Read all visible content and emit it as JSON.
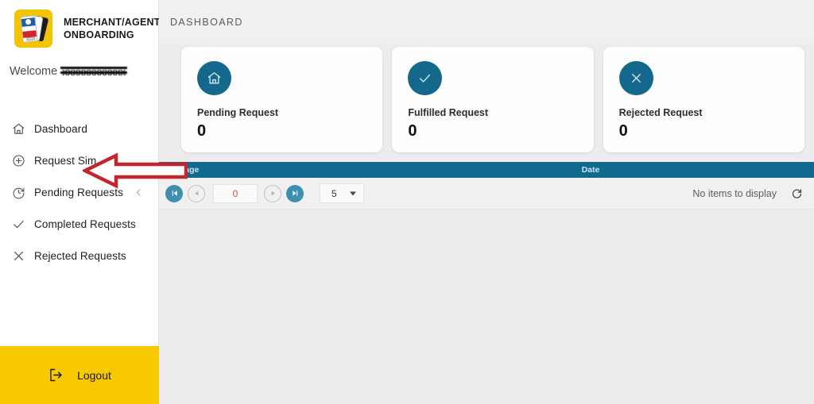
{
  "brand": {
    "title": "MERCHANT/AGENT ONBOARDING",
    "logo_icon": "sim-cards-logo",
    "logo_bg": "#f5c400"
  },
  "welcome": {
    "prefix": "Welcome",
    "username_redacted": "xxxxxxxxxxxx"
  },
  "sidebar": {
    "items": [
      {
        "label": "Dashboard",
        "icon": "home-icon",
        "chevron": ""
      },
      {
        "label": "Request Sim",
        "icon": "plus-circle-icon",
        "chevron": ""
      },
      {
        "label": "Pending Requests",
        "icon": "history-clock-icon",
        "chevron": "chevron-left-icon"
      },
      {
        "label": "Completed Requests",
        "icon": "check-icon",
        "chevron": ""
      },
      {
        "label": "Rejected Requests",
        "icon": "x-icon",
        "chevron": ""
      }
    ],
    "logout": {
      "label": "Logout",
      "icon": "logout-icon",
      "bg": "#f8c800"
    }
  },
  "header": {
    "breadcrumb": "DASHBOARD"
  },
  "cards": [
    {
      "icon": "home-icon",
      "title": "Pending Request",
      "value": "0"
    },
    {
      "icon": "check-icon",
      "title": "Fulfilled Request",
      "value": "0"
    },
    {
      "icon": "x-icon",
      "title": "Rejected Request",
      "value": "0"
    }
  ],
  "table": {
    "columns": [
      "Message",
      "Date"
    ],
    "rows": [],
    "empty_text": "No items to display",
    "header_bg": "#11698e"
  },
  "pagination": {
    "first_icon": "first-page-icon",
    "prev_icon": "prev-page-icon",
    "page_value": "0",
    "next_icon": "next-page-icon",
    "last_icon": "last-page-icon",
    "page_size": "5",
    "refresh_icon": "refresh-icon"
  },
  "annotation": {
    "arrow_icon": "left-arrow-annotation",
    "arrow_color": "#c1272d",
    "points_to": "Request Sim"
  },
  "theme": {
    "accent_teal": "#14688c",
    "accent_yellow": "#f8c800",
    "page_bg": "#edebec"
  }
}
